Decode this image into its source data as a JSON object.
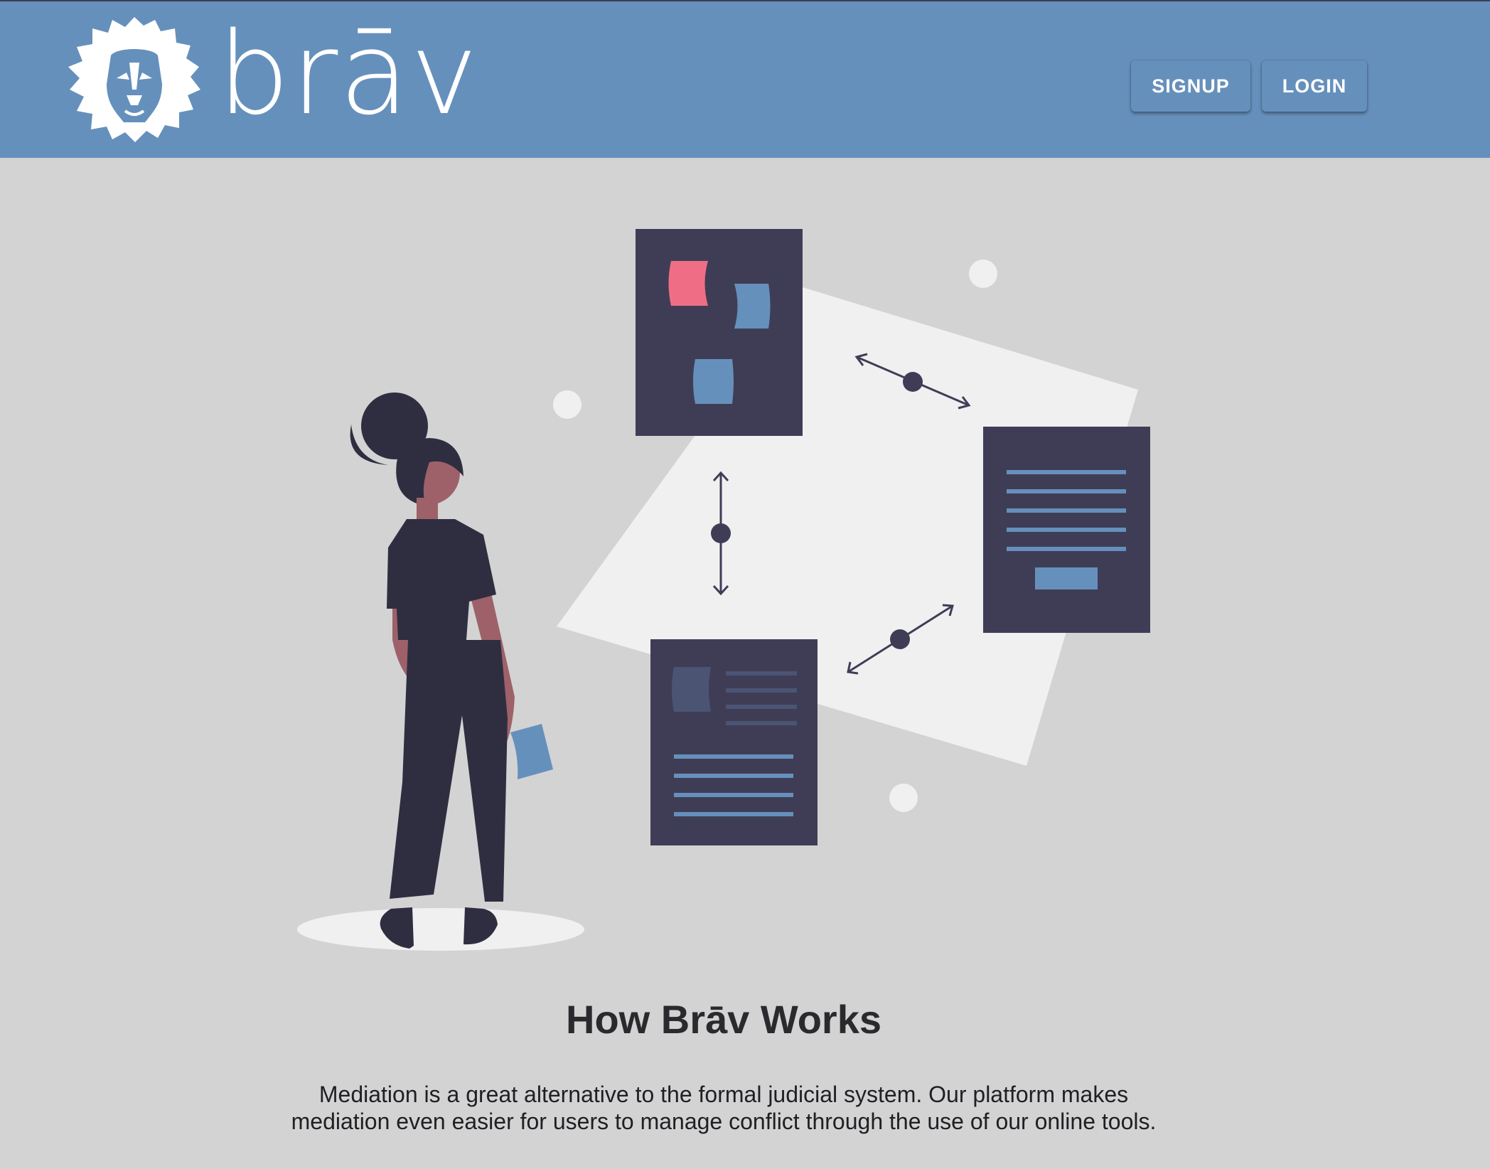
{
  "header": {
    "brand": "brāv",
    "logo_icon": "lion-head-icon",
    "signup_label": "SIGNUP",
    "login_label": "LOGIN"
  },
  "colors": {
    "navbar": "#6690bc",
    "background": "#d3d3d3",
    "dark": "#3f3d56",
    "figure": "#2f2e41",
    "accent_pink": "#f06e85",
    "accent_blue": "#6690bc",
    "panel": "#f0f0f0"
  },
  "main": {
    "illustration": "person-viewing-connected-documents-illustration",
    "heading": "How Brāv Works",
    "description": "Mediation is a great alternative to the formal judicial system. Our platform makes mediation even easier for users to manage conflict through the use of our online tools."
  }
}
